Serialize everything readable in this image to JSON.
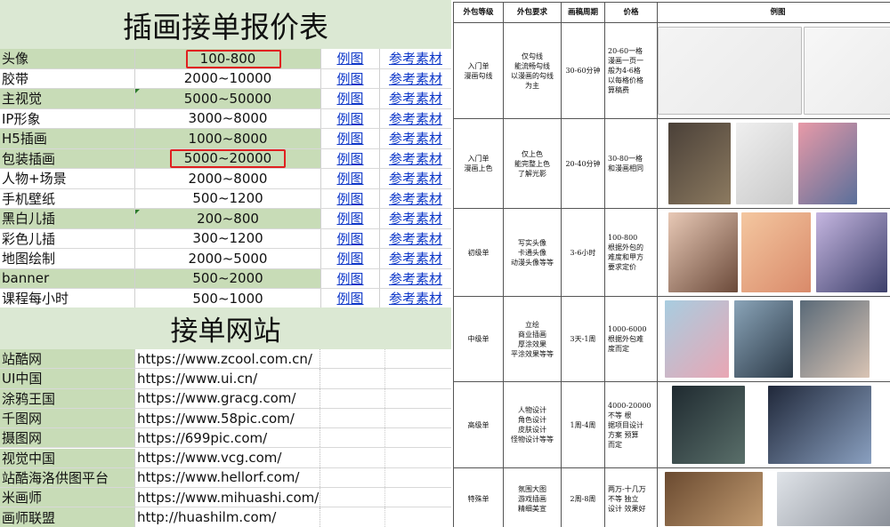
{
  "left_sheet": {
    "title": "插画接单报价表",
    "link_text_example": "例图",
    "link_text_reference": "参考素材",
    "rows": [
      {
        "name": "头像",
        "price": "100-800"
      },
      {
        "name": "胶带",
        "price": "2000~10000"
      },
      {
        "name": "主视觉",
        "price": "5000~50000"
      },
      {
        "name": "IP形象",
        "price": "3000~8000"
      },
      {
        "name": "H5插画",
        "price": "1000~8000"
      },
      {
        "name": "包装插画",
        "price": "5000~20000"
      },
      {
        "name": "人物+场景",
        "price": "2000~8000"
      },
      {
        "name": "手机壁纸",
        "price": "500~1200"
      },
      {
        "name": "黑白儿插",
        "price": "200~800"
      },
      {
        "name": "彩色儿插",
        "price": "300~1200"
      },
      {
        "name": "地图绘制",
        "price": "2000~5000"
      },
      {
        "name": "banner",
        "price": "500~2000"
      },
      {
        "name": "课程每小时",
        "price": "500~1000"
      }
    ],
    "sites_title": "接单网站",
    "sites": [
      {
        "name": "站酷网",
        "url": "https://www.zcool.com.cn/"
      },
      {
        "name": "UI中国",
        "url": "https://www.ui.cn/"
      },
      {
        "name": "涂鸦王国",
        "url": "https://www.gracg.com/"
      },
      {
        "name": "千图网",
        "url": "https://www.58pic.com/"
      },
      {
        "name": "摄图网",
        "url": "https://699pic.com/"
      },
      {
        "name": "视觉中国",
        "url": "https://www.vcg.com/"
      },
      {
        "name": "站酷海洛供图平台",
        "url": "https://www.hellorf.com/"
      },
      {
        "name": "米画师",
        "url": "https://www.mihuashi.com/"
      },
      {
        "name": "画师联盟",
        "url": "http://huashilm.com/"
      }
    ],
    "colors": {
      "header_bg": "#dbe8d3",
      "row_green": "#c8dcb7",
      "link": "#0b35c8",
      "highlight_box": "#e02020"
    }
  },
  "right_table": {
    "headers": [
      "外包等级",
      "外包要求",
      "画稿周期",
      "价格",
      "例图"
    ],
    "rows": [
      {
        "level": "入门单\n漫画勾线",
        "req": "仅勾线\n能流畅勾线\n以漫画的勾线\n为主",
        "cycle": "30-60分钟",
        "price": "20-60一格\n漫画一页一\n般为4-6格\n以每格价格\n算稿费"
      },
      {
        "level": "入门单\n漫画上色",
        "req": "仅上色\n能完整上色\n了解光影",
        "cycle": "20-40分钟",
        "price": "30-80一格\n和漫画相同"
      },
      {
        "level": "初级单",
        "req": "写实头像\n卡通头像\n动漫头像等等",
        "cycle": "3-6小时",
        "price": "100-800\n根据外包的\n难度和甲方\n要求定价"
      },
      {
        "level": "中级单",
        "req": "立绘\n商业插画\n厚涂效果\n平涂效果等等",
        "cycle": "3天-1周",
        "price": "1000-6000\n根据外包难\n度而定"
      },
      {
        "level": "高级单",
        "req": "人物设计\n角色设计\n皮肤设计\n怪物设计等等",
        "cycle": "1周-4周",
        "price": "4000-20000\n不等    根\n据项目设计\n方案    预算\n而定"
      },
      {
        "level": "特殊单",
        "req": "氛围大图\n游戏插画\n精细美宣",
        "cycle": "2周-8周",
        "price": "两万-十几万\n不等    独立\n设计  效果好"
      }
    ],
    "example_icon_names": [
      "manga-lineart-image",
      "manga-color-image",
      "portrait-avatar-image",
      "character-illustration-image",
      "character-design-image",
      "key-art-image"
    ]
  }
}
